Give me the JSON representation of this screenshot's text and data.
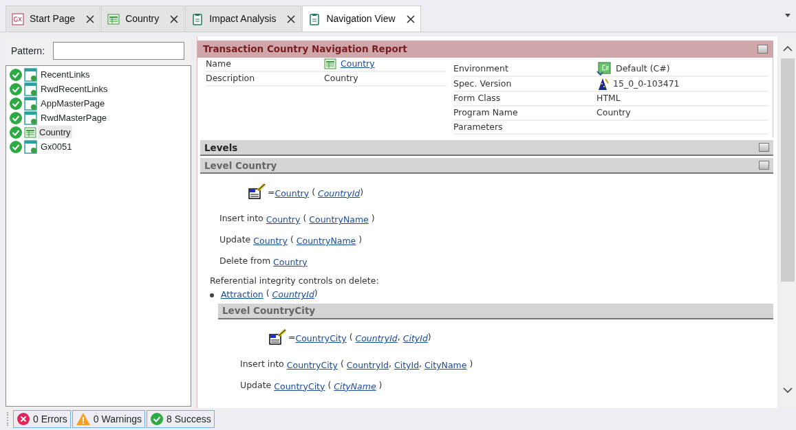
{
  "tabs": [
    {
      "label": "Start Page",
      "kind": "start",
      "selected": false
    },
    {
      "label": "Country",
      "kind": "transaction",
      "selected": false
    },
    {
      "label": "Impact Analysis",
      "kind": "report",
      "selected": false
    },
    {
      "label": "Navigation View",
      "kind": "report",
      "selected": true
    }
  ],
  "sidebar": {
    "pattern_label": "Pattern:",
    "items": [
      {
        "label": "RecentLinks",
        "kind": "webpanel",
        "selected": false
      },
      {
        "label": "RwdRecentLinks",
        "kind": "webpanel",
        "selected": false
      },
      {
        "label": "AppMasterPage",
        "kind": "webpanel",
        "selected": false
      },
      {
        "label": "RwdMasterPage",
        "kind": "webpanel",
        "selected": false
      },
      {
        "label": "Country",
        "kind": "transaction",
        "selected": true
      },
      {
        "label": "Gx0051",
        "kind": "webpanel",
        "selected": false
      }
    ]
  },
  "report": {
    "title": "Transaction Country Navigation Report",
    "left_props": [
      {
        "label": "Name",
        "value": "Country",
        "kind": "object_link"
      },
      {
        "label": "Description",
        "value": "Country",
        "kind": "plain"
      }
    ],
    "right_props": [
      {
        "label": "Environment",
        "value": "Default (C#)",
        "kind": "environment"
      },
      {
        "label": "Spec. Version",
        "value": "15_0_0-103471",
        "kind": "version"
      },
      {
        "label": "Form Class",
        "value": "HTML",
        "kind": "plain"
      },
      {
        "label": "Program Name",
        "value": "Country",
        "kind": "plain"
      },
      {
        "label": "Parameters"
      }
    ],
    "levels_title": "Levels",
    "levels": [
      {
        "title": "Level Country",
        "blocks": [
          {
            "kind": "access",
            "parts": [
              {
                "kind": "text",
                "text": "="
              },
              {
                "kind": "link",
                "text": "Country"
              },
              {
                "kind": "text",
                "text": " ( "
              },
              {
                "kind": "key",
                "text": "CountryId"
              },
              {
                "kind": "text",
                "text": ")"
              }
            ]
          },
          {
            "kind": "statement",
            "parts": [
              {
                "kind": "text",
                "text": "Insert into "
              },
              {
                "kind": "link",
                "text": "Country"
              },
              {
                "kind": "text",
                "text": " ( "
              },
              {
                "kind": "link",
                "text": "CountryName"
              },
              {
                "kind": "text",
                "text": " )"
              }
            ]
          },
          {
            "kind": "statement",
            "parts": [
              {
                "kind": "text",
                "text": "Update "
              },
              {
                "kind": "link",
                "text": "Country"
              },
              {
                "kind": "text",
                "text": " ( "
              },
              {
                "kind": "link",
                "text": "CountryName"
              },
              {
                "kind": "text",
                "text": " )"
              }
            ]
          },
          {
            "kind": "statement",
            "parts": [
              {
                "kind": "text",
                "text": "Delete from "
              },
              {
                "kind": "link",
                "text": "Country"
              }
            ]
          },
          {
            "kind": "note",
            "parts": [
              {
                "kind": "text",
                "text": "Referential integrity controls on delete:"
              }
            ]
          },
          {
            "kind": "bullet",
            "parts": [
              {
                "kind": "link",
                "text": "Attraction"
              },
              {
                "kind": "text",
                "text": " ( "
              },
              {
                "kind": "key",
                "text": "CountryId"
              },
              {
                "kind": "text",
                "text": ")"
              }
            ]
          }
        ],
        "children": [
          {
            "title": "Level CountryCity",
            "blocks": [
              {
                "kind": "access",
                "parts": [
                  {
                    "kind": "text",
                    "text": "="
                  },
                  {
                    "kind": "link",
                    "text": "CountryCity"
                  },
                  {
                    "kind": "text",
                    "text": " ( "
                  },
                  {
                    "kind": "key",
                    "text": "CountryId"
                  },
                  {
                    "kind": "text",
                    "text": ", "
                  },
                  {
                    "kind": "key",
                    "text": "CityId"
                  },
                  {
                    "kind": "text",
                    "text": ")"
                  }
                ]
              },
              {
                "kind": "statement",
                "parts": [
                  {
                    "kind": "text",
                    "text": "Insert into "
                  },
                  {
                    "kind": "link",
                    "text": "CountryCity"
                  },
                  {
                    "kind": "text",
                    "text": " ( "
                  },
                  {
                    "kind": "link",
                    "text": "CountryId"
                  },
                  {
                    "kind": "text",
                    "text": ", "
                  },
                  {
                    "kind": "link",
                    "text": "CityId"
                  },
                  {
                    "kind": "text",
                    "text": ", "
                  },
                  {
                    "kind": "link",
                    "text": "CityName"
                  },
                  {
                    "kind": "text",
                    "text": " )"
                  }
                ]
              },
              {
                "kind": "statement",
                "parts": [
                  {
                    "kind": "text",
                    "text": "Update "
                  },
                  {
                    "kind": "link",
                    "text": "CountryCity"
                  },
                  {
                    "kind": "text",
                    "text": " ( "
                  },
                  {
                    "kind": "key",
                    "text": "CityName"
                  },
                  {
                    "kind": "text",
                    "text": " )"
                  }
                ]
              }
            ]
          }
        ]
      }
    ]
  },
  "status_bar": [
    {
      "kind": "error",
      "text": "0 Errors"
    },
    {
      "kind": "warning",
      "text": "0 Warnings"
    },
    {
      "kind": "success",
      "text": "8 Success"
    }
  ]
}
